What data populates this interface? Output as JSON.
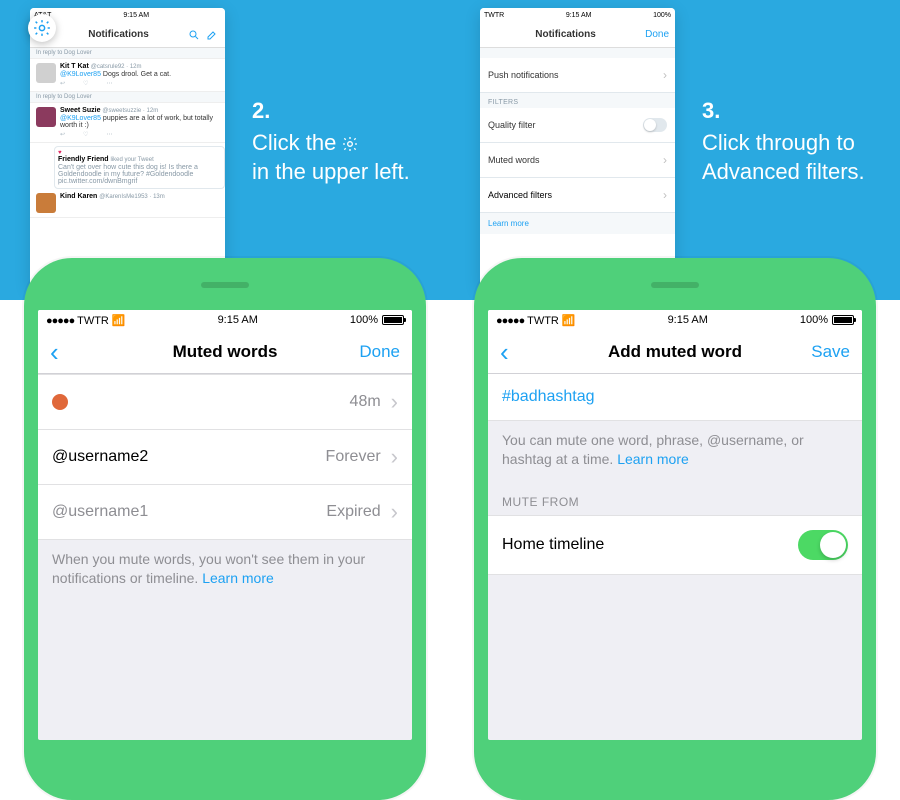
{
  "step2": {
    "num": "2.",
    "text_a": "Click the",
    "text_b": "in the upper left.",
    "status": {
      "carrier": "AT&T",
      "time": "9:15 AM"
    },
    "nav_title": "Notifications",
    "tweets": [
      {
        "reply": "In reply to Dog Lover",
        "name": "Kit T Kat",
        "handle": "@catsrule92 · 12m",
        "mention": "@K9Lover85",
        "text": "Dogs drool. Get a cat."
      },
      {
        "reply": "In reply to Dog Lover",
        "name": "Sweet Suzie",
        "handle": "@sweetsuzzie · 12m",
        "mention": "@K9Lover85",
        "text": "puppies are a lot of work, but totally worth it :)"
      }
    ],
    "quoted": {
      "name": "Friendly Friend",
      "liked": "liked your Tweet",
      "text": "Can't get over how cute this dog is! Is there a Goldendoodle in my future? #Goldendoodle pic.twitter.com/dwnBmgrif"
    },
    "last": {
      "name": "Kind Karen",
      "handle": "@KarenIsMe1953 · 13m"
    }
  },
  "step3": {
    "num": "3.",
    "text": "Click through to Advanced filters.",
    "status": {
      "carrier": "TWTR",
      "time": "9:15 AM",
      "batt": "100%"
    },
    "nav_title": "Notifications",
    "done": "Done",
    "rows": {
      "push": "Push notifications",
      "filters_h": "FILTERS",
      "quality": "Quality filter",
      "muted": "Muted words",
      "advanced": "Advanced filters",
      "learn": "Learn more"
    }
  },
  "muted": {
    "status": {
      "carrier": "TWTR",
      "time": "9:15 AM",
      "batt": "100%"
    },
    "title": "Muted words",
    "done": "Done",
    "rows": [
      {
        "label_is_emoji": true,
        "right": "48m"
      },
      {
        "label": "@username2",
        "right": "Forever"
      },
      {
        "label": "@username1",
        "right": "Expired"
      }
    ],
    "footnote": "When you mute words, you won't see them in your notifications or timeline.",
    "learn": "Learn more"
  },
  "add": {
    "status": {
      "carrier": "TWTR",
      "time": "9:15 AM",
      "batt": "100%"
    },
    "title": "Add muted word",
    "save": "Save",
    "input": "#badhashtag",
    "hint": "You can mute one word, phrase, @username, or hashtag at a time.",
    "learn": "Learn more",
    "section": "MUTE FROM",
    "row1": "Home timeline"
  }
}
